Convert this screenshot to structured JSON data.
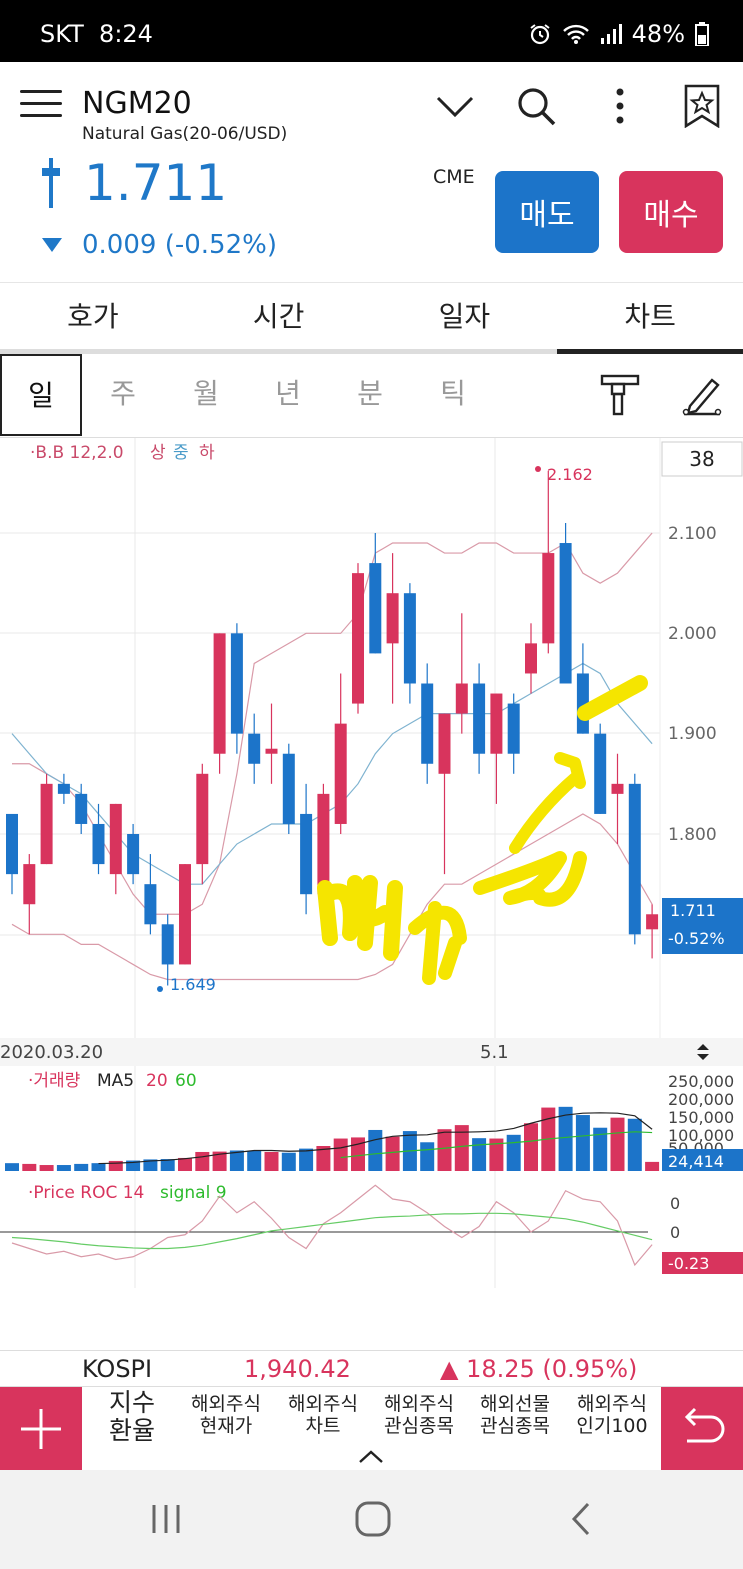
{
  "status": {
    "carrier": "SKT",
    "time": "8:24",
    "battery": "48%"
  },
  "header": {
    "symbol": "NGM20",
    "name": "Natural Gas(20-06/USD)",
    "price": "1.711",
    "change": "0.009 (-0.52%)",
    "exchange": "CME",
    "sell_label": "매도",
    "buy_label": "매수"
  },
  "tabs": [
    "호가",
    "시간",
    "일자",
    "차트"
  ],
  "periods": [
    "일",
    "주",
    "월",
    "년",
    "분",
    "틱"
  ],
  "chart": {
    "bb_prefix": "·B.B 12,2.0",
    "bb_labels": [
      "상",
      "중",
      "하"
    ],
    "count": "38",
    "high_label": "2.162",
    "low_label": "1.649",
    "last_price": "1.711",
    "last_change": "-0.52%",
    "date_start": "2020.03.20",
    "date_mid": "5.1",
    "vol_title": "·거래량",
    "vol_ma": [
      "MA5",
      "20",
      "60"
    ],
    "vol_last": "24,414",
    "roc_title": "·Price ROC 14",
    "roc_signal": "signal 9",
    "roc_ticks": [
      "0",
      "0"
    ],
    "roc_last": "-0.23",
    "annotation": "매수"
  },
  "chart_data": {
    "type": "candlestick",
    "price_ticks": [
      "2.100",
      "2.000",
      "1.900",
      "1.800"
    ],
    "price_ylim": [
      1.64,
      2.17
    ],
    "candles": [
      {
        "o": 1.76,
        "h": 1.8,
        "l": 1.74,
        "c": 1.82,
        "dir": "down"
      },
      {
        "o": 1.73,
        "h": 1.78,
        "l": 1.7,
        "c": 1.77,
        "dir": "up"
      },
      {
        "o": 1.77,
        "h": 1.86,
        "l": 1.77,
        "c": 1.85,
        "dir": "up"
      },
      {
        "o": 1.85,
        "h": 1.86,
        "l": 1.83,
        "c": 1.84,
        "dir": "down"
      },
      {
        "o": 1.84,
        "h": 1.85,
        "l": 1.8,
        "c": 1.81,
        "dir": "down"
      },
      {
        "o": 1.81,
        "h": 1.83,
        "l": 1.76,
        "c": 1.77,
        "dir": "down"
      },
      {
        "o": 1.76,
        "h": 1.83,
        "l": 1.74,
        "c": 1.83,
        "dir": "up"
      },
      {
        "o": 1.8,
        "h": 1.81,
        "l": 1.75,
        "c": 1.76,
        "dir": "down"
      },
      {
        "o": 1.75,
        "h": 1.78,
        "l": 1.7,
        "c": 1.71,
        "dir": "down"
      },
      {
        "o": 1.71,
        "h": 1.72,
        "l": 1.649,
        "c": 1.67,
        "dir": "down"
      },
      {
        "o": 1.67,
        "h": 1.77,
        "l": 1.67,
        "c": 1.77,
        "dir": "up"
      },
      {
        "o": 1.77,
        "h": 1.87,
        "l": 1.75,
        "c": 1.86,
        "dir": "up"
      },
      {
        "o": 1.88,
        "h": 2.0,
        "l": 1.86,
        "c": 2.0,
        "dir": "up"
      },
      {
        "o": 2.0,
        "h": 2.01,
        "l": 1.88,
        "c": 1.9,
        "dir": "down"
      },
      {
        "o": 1.9,
        "h": 1.92,
        "l": 1.85,
        "c": 1.87,
        "dir": "down"
      },
      {
        "o": 1.88,
        "h": 1.93,
        "l": 1.85,
        "c": 1.885,
        "dir": "up"
      },
      {
        "o": 1.88,
        "h": 1.89,
        "l": 1.8,
        "c": 1.81,
        "dir": "down"
      },
      {
        "o": 1.82,
        "h": 1.85,
        "l": 1.72,
        "c": 1.74,
        "dir": "down"
      },
      {
        "o": 1.74,
        "h": 1.85,
        "l": 1.74,
        "c": 1.84,
        "dir": "up"
      },
      {
        "o": 1.81,
        "h": 1.96,
        "l": 1.8,
        "c": 1.91,
        "dir": "up"
      },
      {
        "o": 1.93,
        "h": 2.07,
        "l": 1.92,
        "c": 2.06,
        "dir": "up"
      },
      {
        "o": 2.07,
        "h": 2.1,
        "l": 1.98,
        "c": 1.98,
        "dir": "down"
      },
      {
        "o": 2.04,
        "h": 2.08,
        "l": 1.93,
        "c": 1.99,
        "dir": "up"
      },
      {
        "o": 2.04,
        "h": 2.05,
        "l": 1.93,
        "c": 1.95,
        "dir": "down"
      },
      {
        "o": 1.95,
        "h": 1.97,
        "l": 1.85,
        "c": 1.87,
        "dir": "down"
      },
      {
        "o": 1.86,
        "h": 1.92,
        "l": 1.76,
        "c": 1.92,
        "dir": "up"
      },
      {
        "o": 1.92,
        "h": 2.02,
        "l": 1.9,
        "c": 1.95,
        "dir": "up"
      },
      {
        "o": 1.95,
        "h": 1.97,
        "l": 1.86,
        "c": 1.88,
        "dir": "down"
      },
      {
        "o": 1.88,
        "h": 1.94,
        "l": 1.83,
        "c": 1.94,
        "dir": "up"
      },
      {
        "o": 1.93,
        "h": 1.94,
        "l": 1.86,
        "c": 1.88,
        "dir": "down"
      },
      {
        "o": 1.96,
        "h": 2.01,
        "l": 1.94,
        "c": 1.99,
        "dir": "up"
      },
      {
        "o": 1.99,
        "h": 2.162,
        "l": 1.98,
        "c": 2.08,
        "dir": "up"
      },
      {
        "o": 2.09,
        "h": 2.11,
        "l": 1.95,
        "c": 1.95,
        "dir": "down"
      },
      {
        "o": 1.96,
        "h": 1.99,
        "l": 1.9,
        "c": 1.9,
        "dir": "down"
      },
      {
        "o": 1.9,
        "h": 1.91,
        "l": 1.82,
        "c": 1.82,
        "dir": "down"
      },
      {
        "o": 1.85,
        "h": 1.88,
        "l": 1.79,
        "c": 1.84,
        "dir": "up"
      },
      {
        "o": 1.85,
        "h": 1.86,
        "l": 1.69,
        "c": 1.7,
        "dir": "down"
      },
      {
        "o": 1.72,
        "h": 1.73,
        "l": 1.676,
        "c": 1.705,
        "dir": "up"
      }
    ],
    "bb_upper": [
      1.87,
      1.87,
      1.86,
      1.85,
      1.83,
      1.8,
      1.77,
      1.74,
      1.72,
      1.72,
      1.72,
      1.73,
      1.77,
      1.86,
      1.97,
      1.98,
      1.99,
      2.0,
      2.0,
      2.0,
      2.02,
      2.08,
      2.09,
      2.09,
      2.09,
      2.08,
      2.08,
      2.09,
      2.09,
      2.08,
      2.08,
      2.08,
      2.09,
      2.06,
      2.05,
      2.06,
      2.08,
      2.1
    ],
    "bb_middle": [
      1.9,
      1.88,
      1.86,
      1.85,
      1.84,
      1.82,
      1.8,
      1.78,
      1.77,
      1.76,
      1.75,
      1.75,
      1.77,
      1.79,
      1.8,
      1.81,
      1.81,
      1.81,
      1.82,
      1.83,
      1.85,
      1.88,
      1.9,
      1.91,
      1.92,
      1.92,
      1.92,
      1.92,
      1.92,
      1.93,
      1.94,
      1.95,
      1.96,
      1.97,
      1.96,
      1.93,
      1.91,
      1.89
    ],
    "bb_lower": [
      1.71,
      1.7,
      1.7,
      1.7,
      1.69,
      1.69,
      1.68,
      1.67,
      1.66,
      1.655,
      1.655,
      1.655,
      1.655,
      1.655,
      1.655,
      1.655,
      1.655,
      1.655,
      1.655,
      1.655,
      1.655,
      1.66,
      1.67,
      1.7,
      1.73,
      1.75,
      1.75,
      1.76,
      1.77,
      1.78,
      1.79,
      1.8,
      1.81,
      1.82,
      1.81,
      1.79,
      1.76,
      1.73
    ],
    "volume_ticks": [
      "250,000",
      "200,000",
      "150,000",
      "100,000",
      "50,000"
    ],
    "volume_ylim": [
      0,
      260000
    ],
    "volume": [
      21000,
      19000,
      16000,
      16000,
      19000,
      21000,
      27000,
      28000,
      31000,
      32000,
      35000,
      51000,
      52000,
      55000,
      54000,
      51000,
      49000,
      60000,
      67000,
      87000,
      90000,
      110000,
      92000,
      107000,
      77000,
      112000,
      123000,
      88000,
      87000,
      97000,
      128000,
      170000,
      172000,
      150000,
      116000,
      143000,
      140000,
      24414
    ],
    "volume_ma": [
      null,
      null,
      null,
      null,
      null,
      20000,
      21000,
      23000,
      27000,
      29000,
      33000,
      38000,
      45000,
      50000,
      55000,
      55000,
      53000,
      54000,
      58000,
      62000,
      72000,
      84000,
      93000,
      96000,
      97000,
      104000,
      104000,
      105000,
      107000,
      114000,
      128000,
      140000,
      150000,
      155000,
      156000,
      155000,
      148000,
      112000
    ],
    "volume_ma20": [
      null,
      null,
      null,
      null,
      null,
      null,
      null,
      null,
      null,
      null,
      null,
      null,
      null,
      null,
      null,
      null,
      null,
      null,
      null,
      36000,
      41000,
      46000,
      50000,
      54000,
      57000,
      61000,
      66000,
      70000,
      73000,
      76000,
      80000,
      86000,
      90000,
      94000,
      98000,
      102000,
      105000,
      103000
    ],
    "roc_signal": [
      -0.1,
      -0.12,
      -0.15,
      -0.18,
      -0.22,
      -0.25,
      -0.27,
      -0.29,
      -0.3,
      -0.3,
      -0.28,
      -0.24,
      -0.18,
      -0.12,
      -0.05,
      0.02,
      0.06,
      0.1,
      0.14,
      0.18,
      0.22,
      0.26,
      0.28,
      0.29,
      0.31,
      0.33,
      0.33,
      0.34,
      0.34,
      0.33,
      0.3,
      0.27,
      0.24,
      0.18,
      0.1,
      0.02,
      -0.06,
      -0.14
    ],
    "roc_values": [
      -0.2,
      -0.3,
      -0.4,
      -0.35,
      -0.45,
      -0.4,
      -0.5,
      -0.45,
      -0.3,
      -0.1,
      -0.05,
      0.2,
      0.65,
      0.35,
      0.55,
      0.25,
      -0.1,
      -0.3,
      0.15,
      0.35,
      0.6,
      0.85,
      0.6,
      0.55,
      0.35,
      0.1,
      -0.1,
      0.1,
      0.55,
      0.35,
      0.0,
      0.2,
      0.75,
      0.6,
      0.55,
      0.2,
      -0.6,
      -0.23
    ]
  },
  "kospi": {
    "name": "KOSPI",
    "value": "1,940.42",
    "change": "18.25 (0.95%)"
  },
  "bottomnav": [
    {
      "l1": "지수",
      "l2": "환율"
    },
    {
      "l1": "해외주식",
      "l2": "현재가"
    },
    {
      "l1": "해외주식",
      "l2": "차트"
    },
    {
      "l1": "해외주식",
      "l2": "관심종목"
    },
    {
      "l1": "해외선물",
      "l2": "관심종목"
    },
    {
      "l1": "해외주식",
      "l2": "인기100"
    }
  ],
  "colors": {
    "up": "#d8345d",
    "down": "#1c74c9",
    "bb_band": "#d99aa8",
    "bb_mid": "#7fb3d0",
    "annotation": "#f5e500"
  }
}
